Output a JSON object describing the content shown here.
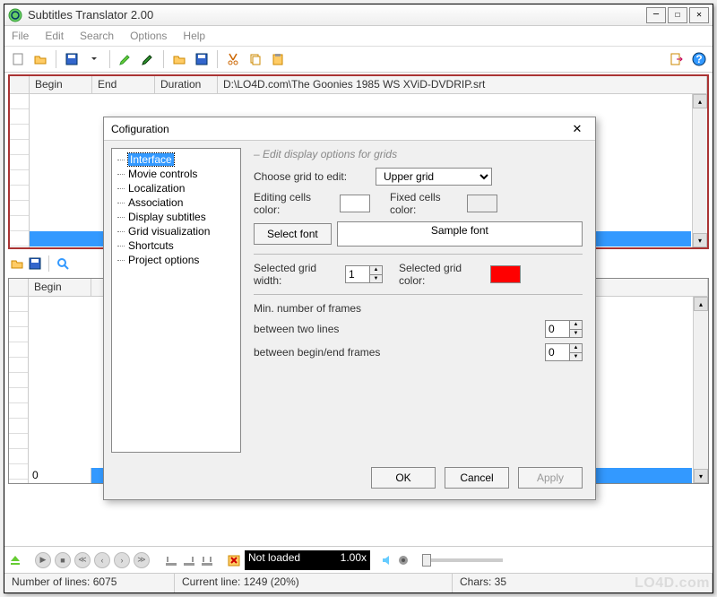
{
  "window": {
    "title": "Subtitles Translator 2.00"
  },
  "menu": {
    "file": "File",
    "edit": "Edit",
    "search": "Search",
    "options": "Options",
    "help": "Help"
  },
  "grid1": {
    "col_begin": "Begin",
    "col_end": "End",
    "col_duration": "Duration",
    "file_header": "D:\\LO4D.com\\The Goonies 1985 WS XViD-DVDRIP.srt"
  },
  "grid2": {
    "col_begin": "Begin",
    "cell_value": "0"
  },
  "dialog": {
    "title": "Cofiguration",
    "tree": {
      "interface": "Interface",
      "movie_controls": "Movie controls",
      "localization": "Localization",
      "association": "Association",
      "display_subtitles": "Display subtitles",
      "grid_visualization": "Grid visualization",
      "shortcuts": "Shortcuts",
      "project_options": "Project options"
    },
    "panel": {
      "group_title": "Edit display options for grids",
      "choose_grid_label": "Choose grid to edit:",
      "choose_grid_value": "Upper grid",
      "editing_cells_label": "Editing cells color:",
      "fixed_cells_label": "Fixed cells color:",
      "select_font_btn": "Select font",
      "sample_font": "Sample font",
      "selected_grid_width_label": "Selected grid width:",
      "selected_grid_width_value": "1",
      "selected_grid_color_label": "Selected grid color:",
      "min_frames_label": "Min. number of frames",
      "between_two_lines": "between two lines",
      "between_two_lines_value": "0",
      "between_begin_end": "between begin/end frames",
      "between_begin_end_value": "0"
    },
    "buttons": {
      "ok": "OK",
      "cancel": "Cancel",
      "apply": "Apply"
    }
  },
  "player": {
    "status": "Not loaded",
    "speed": "1.00x"
  },
  "status": {
    "lines": "Number of lines: 6075",
    "current": "Current line: 1249 (20%)",
    "chars": "Chars: 35"
  },
  "watermark": "LO4D.com"
}
